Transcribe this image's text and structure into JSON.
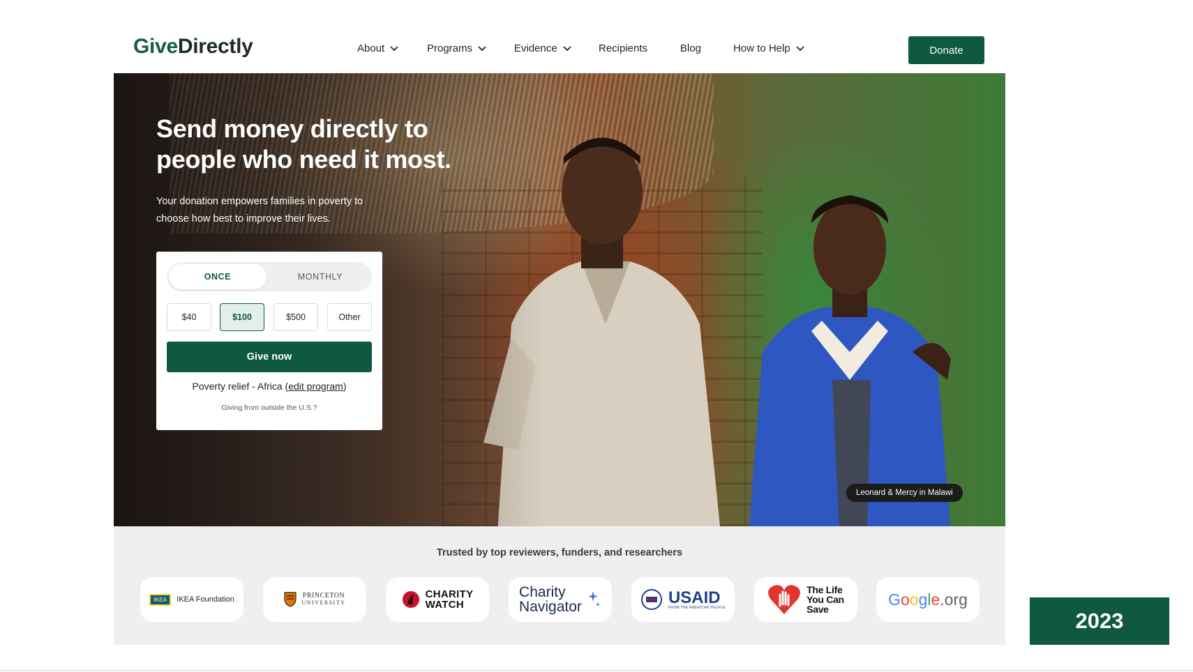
{
  "brand": {
    "logo_part1": "Give",
    "logo_part2": "Directly",
    "primary_color": "#0f5841"
  },
  "nav": {
    "items": [
      {
        "label": "About",
        "dropdown": true
      },
      {
        "label": "Programs",
        "dropdown": true
      },
      {
        "label": "Evidence",
        "dropdown": true
      },
      {
        "label": "Recipients",
        "dropdown": false
      },
      {
        "label": "Blog",
        "dropdown": false
      },
      {
        "label": "How to Help",
        "dropdown": true
      }
    ],
    "donate_label": "Donate"
  },
  "hero": {
    "title": "Send money directly to people who need it most.",
    "subtitle": "Your donation empowers families in poverty to choose how best to improve their lives.",
    "photo_caption": "Leonard & Mercy in Malawi"
  },
  "donation": {
    "frequency": {
      "once": "ONCE",
      "monthly": "MONTHLY",
      "selected": "once"
    },
    "amounts": [
      "$40",
      "$100",
      "$500",
      "Other"
    ],
    "selected_amount": "$100",
    "give_label": "Give now",
    "program_prefix": "Poverty relief - Africa (",
    "program_link": "edit program",
    "program_suffix": ")",
    "outside_us": "Giving from outside the U.S.?"
  },
  "trusted": {
    "title": "Trusted by top reviewers, funders, and researchers",
    "logos": {
      "ikea": {
        "mark": "IKEA",
        "text": "IKEA Foundation"
      },
      "princeton": {
        "line1": "PRINCETON",
        "line2": "UNIVERSITY"
      },
      "charitywatch": {
        "line1": "CHARITY",
        "line2": "WATCH"
      },
      "charitynav": {
        "line1": "Charity",
        "line2": "Navigator"
      },
      "usaid": {
        "text": "USAID",
        "sub": "FROM THE AMERICAN PEOPLE"
      },
      "tlycs": {
        "line1": "The Life",
        "line2": "You Can",
        "line3": "Save"
      },
      "google": {
        "g": "G",
        "o1": "o",
        "o2": "o",
        "g2": "g",
        "l": "l",
        "e": "e",
        "org": ".org"
      }
    }
  },
  "year_badge": "2023",
  "icons": {
    "dropdown": "chevron-down-icon"
  }
}
